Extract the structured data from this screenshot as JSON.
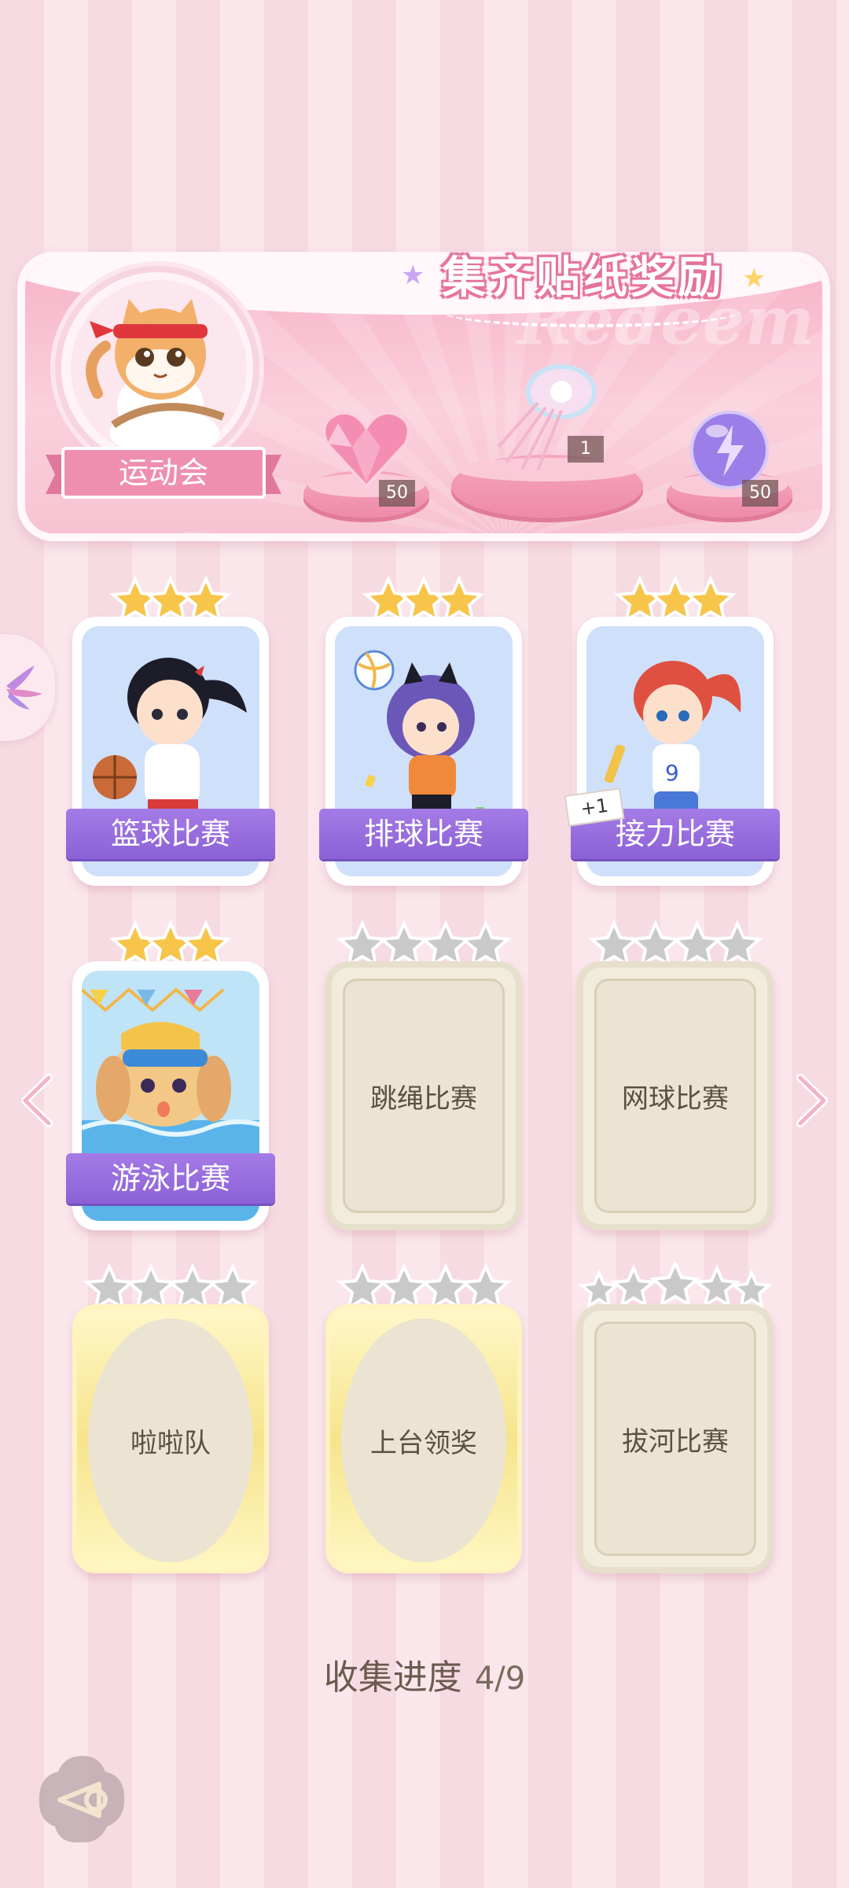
{
  "banner": {
    "title": "集齐贴纸奖励",
    "watermark": "Redeem",
    "medal_label": "运动会",
    "rewards": [
      {
        "icon": "pink-heart-gem-icon",
        "count": "50"
      },
      {
        "icon": "jellyfish-ornament-icon",
        "count": "1"
      },
      {
        "icon": "lightning-orb-icon",
        "count": "50"
      }
    ]
  },
  "stickers": [
    {
      "name": "篮球比赛",
      "collected": true,
      "stars": 3
    },
    {
      "name": "排球比赛",
      "collected": true,
      "stars": 3
    },
    {
      "name": "接力比赛",
      "collected": true,
      "stars": 3,
      "badge": "+1"
    },
    {
      "name": "游泳比赛",
      "collected": true,
      "stars": 3
    },
    {
      "name": "跳绳比赛",
      "collected": false,
      "stars": 4
    },
    {
      "name": "网球比赛",
      "collected": false,
      "stars": 4
    },
    {
      "name": "啦啦队",
      "collected": false,
      "stars": 4
    },
    {
      "name": "上台领奖",
      "collected": false,
      "stars": 4
    },
    {
      "name": "拔河比赛",
      "collected": false,
      "stars": 5
    }
  ],
  "progress": {
    "label": "收集进度",
    "value": "4/9"
  },
  "colors": {
    "accent_purple": "#8c61d6",
    "gold_star": "#f6c54a",
    "grey_star": "#c9c9c9",
    "banner_pink": "#f7b3c8"
  }
}
